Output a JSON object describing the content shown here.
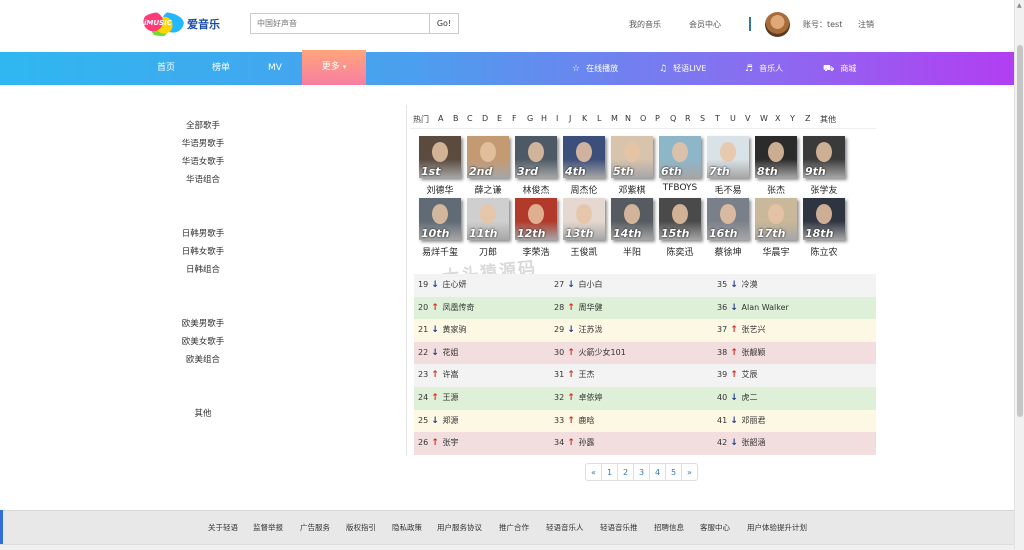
{
  "header": {
    "logo_badge": "iMUSIC",
    "logo_text": "爱音乐",
    "search_placeholder": "中国好声音",
    "search_button": "Go!",
    "my_music": "我的音乐",
    "member_center": "会员中心",
    "account": "账号：test",
    "logout": "注销"
  },
  "nav": {
    "home": "首页",
    "charts": "榜单",
    "mv": "MV",
    "more": "更多",
    "more_caret": "▾",
    "online_play": "在线播放",
    "live": "轻语LIVE",
    "musician": "音乐人",
    "shop": "商城"
  },
  "sidebar": {
    "all": "全部歌手",
    "cn_male": "华语男歌手",
    "cn_female": "华语女歌手",
    "cn_group": "华语组合",
    "jk_male": "日韩男歌手",
    "jk_female": "日韩女歌手",
    "jk_group": "日韩组合",
    "eu_male": "欧美男歌手",
    "eu_female": "欧美女歌手",
    "eu_group": "欧美组合",
    "other": "其他"
  },
  "letters": [
    "热门",
    "A",
    "B",
    "C",
    "D",
    "E",
    "F",
    "G",
    "H",
    "I",
    "J",
    "K",
    "L",
    "M",
    "N",
    "O",
    "P",
    "Q",
    "R",
    "S",
    "T",
    "U",
    "V",
    "W",
    "X",
    "Y",
    "Z",
    "其他"
  ],
  "top_artists": [
    {
      "rank": "1st",
      "name": "刘德华",
      "color": "#5b4a3e"
    },
    {
      "rank": "2nd",
      "name": "薛之谦",
      "color": "#c49a72"
    },
    {
      "rank": "3rd",
      "name": "林俊杰",
      "color": "#4d5a66"
    },
    {
      "rank": "4th",
      "name": "周杰伦",
      "color": "#3c4e7a"
    },
    {
      "rank": "5th",
      "name": "邓紫棋",
      "color": "#d8c3ad"
    },
    {
      "rank": "6th",
      "name": "TFBOYS",
      "color": "#8db7c9"
    },
    {
      "rank": "7th",
      "name": "毛不易",
      "color": "#d9e2e6"
    },
    {
      "rank": "8th",
      "name": "张杰",
      "color": "#2b2b2b"
    },
    {
      "rank": "9th",
      "name": "张学友",
      "color": "#3a3a3a"
    },
    {
      "rank": "10th",
      "name": "易烊千玺",
      "color": "#606b75"
    },
    {
      "rank": "11th",
      "name": "刀郎",
      "color": "#cfcfcf"
    },
    {
      "rank": "12th",
      "name": "李荣浩",
      "color": "#b23a2a"
    },
    {
      "rank": "13th",
      "name": "王俊凯",
      "color": "#e4d8d0"
    },
    {
      "rank": "14th",
      "name": "半阳",
      "color": "#555b61"
    },
    {
      "rank": "15th",
      "name": "陈奕迅",
      "color": "#4a4a4a"
    },
    {
      "rank": "16th",
      "name": "蔡徐坤",
      "color": "#7a808a"
    },
    {
      "rank": "17th",
      "name": "华晨宇",
      "color": "#c9b89a"
    },
    {
      "rank": "18th",
      "name": "陈立农",
      "color": "#2e3440"
    }
  ],
  "watermark": "大头猿源码",
  "row_colors": [
    "#f3f3f3",
    "#dff0d8",
    "#fcf8e3",
    "#f2dede",
    "#f3f3f3",
    "#dff0d8",
    "#fcf8e3",
    "#f2dede"
  ],
  "ranking": [
    [
      {
        "n": "19",
        "d": "down",
        "name": "庄心妍"
      },
      {
        "n": "27",
        "d": "down",
        "name": "白小白"
      },
      {
        "n": "35",
        "d": "down",
        "name": "冷漠"
      }
    ],
    [
      {
        "n": "20",
        "d": "up",
        "name": "凤凰传奇"
      },
      {
        "n": "28",
        "d": "up",
        "name": "周华健"
      },
      {
        "n": "36",
        "d": "down",
        "name": "Alan Walker"
      }
    ],
    [
      {
        "n": "21",
        "d": "down",
        "name": "黄家驹"
      },
      {
        "n": "29",
        "d": "down",
        "name": "汪苏泷"
      },
      {
        "n": "37",
        "d": "up",
        "name": "张艺兴"
      }
    ],
    [
      {
        "n": "22",
        "d": "down",
        "name": "花姐"
      },
      {
        "n": "30",
        "d": "up",
        "name": "火箭少女101"
      },
      {
        "n": "38",
        "d": "up",
        "name": "张靓颖"
      }
    ],
    [
      {
        "n": "23",
        "d": "up",
        "name": "许嵩"
      },
      {
        "n": "31",
        "d": "up",
        "name": "王杰"
      },
      {
        "n": "39",
        "d": "up",
        "name": "艾辰"
      }
    ],
    [
      {
        "n": "24",
        "d": "up",
        "name": "王源"
      },
      {
        "n": "32",
        "d": "up",
        "name": "卓依婷"
      },
      {
        "n": "40",
        "d": "down",
        "name": "虎二"
      }
    ],
    [
      {
        "n": "25",
        "d": "down",
        "name": "郑源"
      },
      {
        "n": "33",
        "d": "up",
        "name": "鹿晗"
      },
      {
        "n": "41",
        "d": "down",
        "name": "邓丽君"
      }
    ],
    [
      {
        "n": "26",
        "d": "up",
        "name": "张宇"
      },
      {
        "n": "34",
        "d": "up",
        "name": "孙露"
      },
      {
        "n": "42",
        "d": "down",
        "name": "张韶涵"
      }
    ]
  ],
  "pager": [
    "«",
    "1",
    "2",
    "3",
    "4",
    "5",
    "»"
  ],
  "footer": [
    "关于轻语",
    "监督举报",
    "广告服务",
    "版权指引",
    "隐私政策",
    "用户服务协议",
    "推广合作",
    "轻语音乐人",
    "轻语音乐推",
    "招聘信息",
    "客服中心",
    "用户体验提升计划"
  ]
}
